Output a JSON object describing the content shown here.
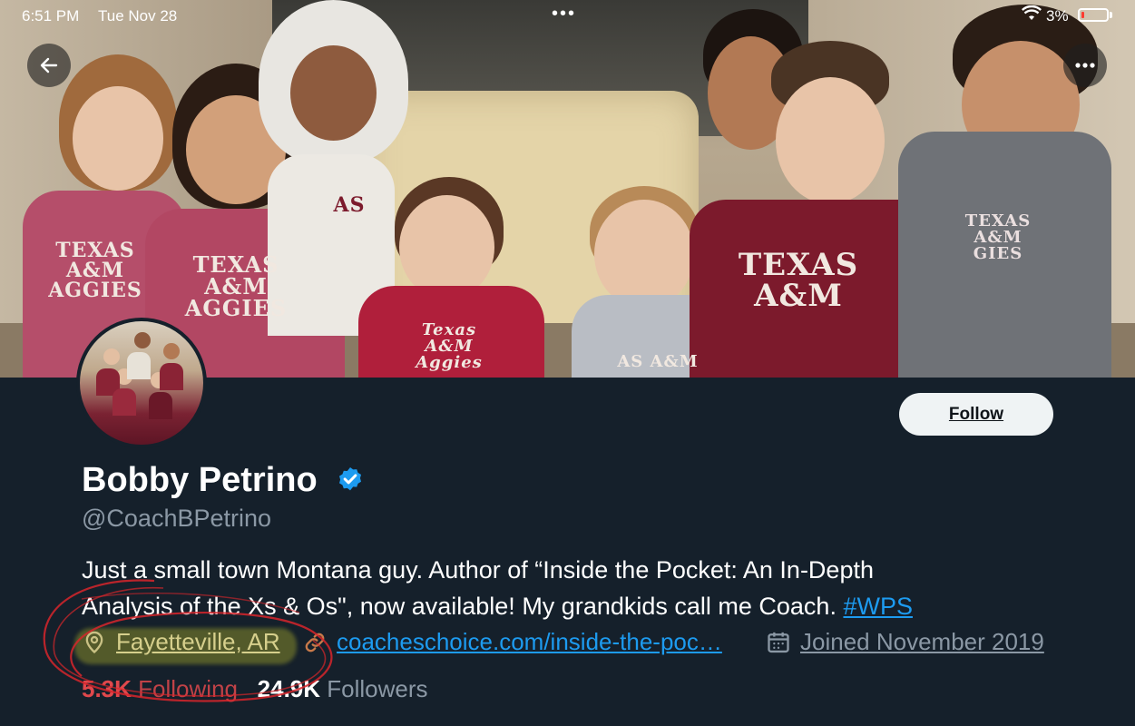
{
  "status_bar": {
    "time": "6:51 PM",
    "date": "Tue Nov 28",
    "center": "•••",
    "battery": "3%"
  },
  "banner": {
    "shirts": [
      "TEXAS A&M\nAGGIES",
      "TEXAS A&M\nAGGIES",
      "AS",
      "Texas A&M\nAggies",
      "TEXAS A&M",
      "AS A&M",
      "TEXAS A&M\nGIES"
    ]
  },
  "header": {
    "back_icon": "arrow-left-icon",
    "more_icon": "ellipsis-icon"
  },
  "profile": {
    "follow_label": "Follow",
    "name": "Bobby Petrino",
    "handle": "@CoachBPetrino",
    "bio_line1": "Just a small town Montana guy. Author of “Inside the Pocket: An In-Depth",
    "bio_line2_prefix": "Analysis of the Xs & Os\", now available! My grandkids call me Coach. ",
    "bio_hashtag": "#WPS",
    "location": "Fayetteville, AR",
    "website": "coacheschoice.com/inside-the-poc…",
    "joined": "Joined November 2019",
    "following_count": "5.3K",
    "following_label": "Following",
    "followers_count": "24.9K",
    "followers_label": "Followers"
  },
  "colors": {
    "background": "#15202b",
    "accent": "#1d9bf0",
    "annotation_red": "#d7262b"
  }
}
